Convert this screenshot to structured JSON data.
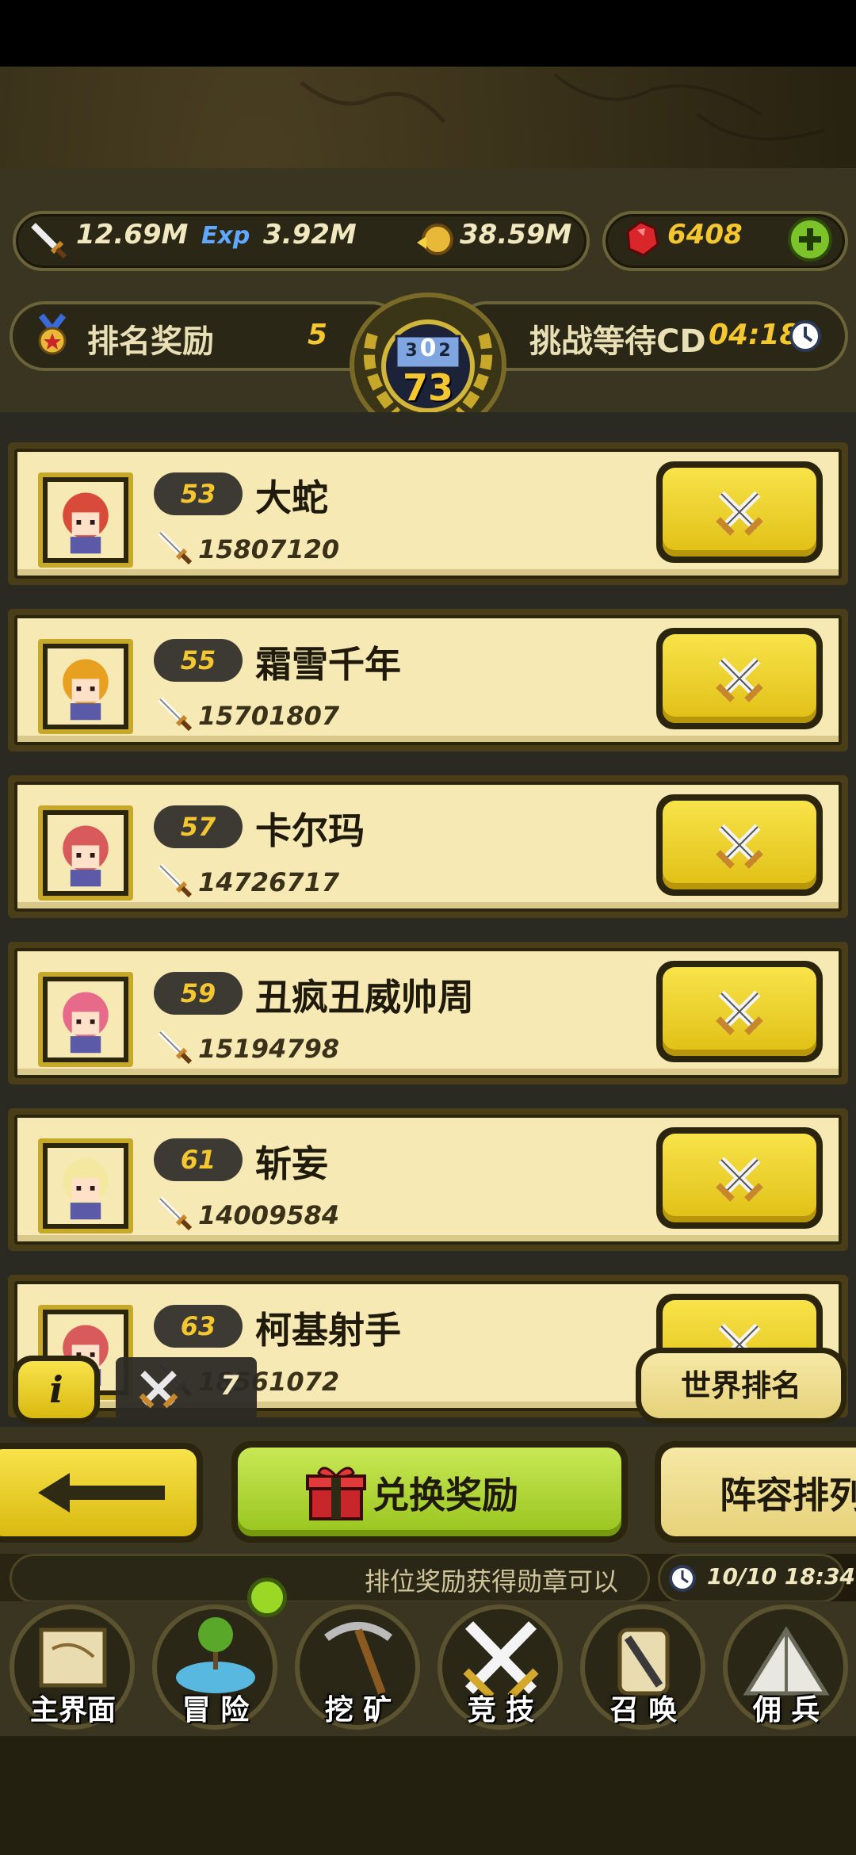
{
  "resources": {
    "attack_value": "12.69M",
    "exp_value": "3.92M",
    "gold_value": "38.59M",
    "gem_value": "6408",
    "exp_icon_text": "Exp"
  },
  "rank_bar": {
    "reward_label": "排名奖励",
    "reward_value": "5",
    "badge_digits": "73",
    "badge_top_digits": [
      "3",
      "0",
      "2"
    ],
    "cd_label": "挑战等待CD",
    "cd_value": "04:18"
  },
  "opponents": [
    {
      "level": "53",
      "name": "大蛇",
      "power": "15807120"
    },
    {
      "level": "55",
      "name": "霜雪千年",
      "power": "15701807"
    },
    {
      "level": "57",
      "name": "卡尔玛",
      "power": "14726717"
    },
    {
      "level": "59",
      "name": "丑疯丑威帅周",
      "power": "15194798"
    },
    {
      "level": "61",
      "name": "斩妄",
      "power": "14009584"
    },
    {
      "level": "63",
      "name": "柯基射手",
      "power": "18561072"
    }
  ],
  "overlay": {
    "info_label": "i",
    "attempts_value": "7",
    "world_rank_label": "世界排名"
  },
  "actions": {
    "redeem_label": "兑换奖励",
    "lineup_label": "阵容排列"
  },
  "ticker": {
    "text": "排位奖励获得勋章可以",
    "datetime": "10/10 18:34"
  },
  "nav": [
    {
      "label": "主界面",
      "icon": "scroll-map-icon"
    },
    {
      "label": "冒 险",
      "icon": "island-icon"
    },
    {
      "label": "挖 矿",
      "icon": "pickaxe-icon"
    },
    {
      "label": "竞 技",
      "icon": "crossed-swords-icon"
    },
    {
      "label": "召 唤",
      "icon": "summon-scroll-icon"
    },
    {
      "label": "佣 兵",
      "icon": "tent-icon"
    }
  ],
  "colors": {
    "accent_yellow": "#f4c630",
    "row_bg": "#f6e9b4",
    "redeem_green": "#a8d02a"
  }
}
